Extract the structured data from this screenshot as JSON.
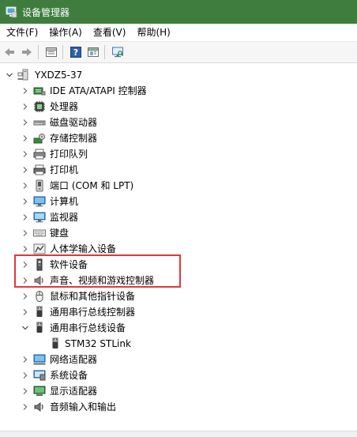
{
  "window": {
    "title": "设备管理器",
    "titlebar_color": "#3f7d3e"
  },
  "menu": {
    "items": [
      {
        "label": "文件(F)"
      },
      {
        "label": "操作(A)"
      },
      {
        "label": "查看(V)"
      },
      {
        "label": "帮助(H)"
      }
    ]
  },
  "toolbar": {
    "buttons": [
      {
        "icon": "back-arrow-icon"
      },
      {
        "icon": "forward-arrow-icon"
      },
      {
        "icon": "properties-icon"
      },
      {
        "icon": "help-icon"
      },
      {
        "icon": "update-driver-icon"
      },
      {
        "icon": "scan-hardware-icon"
      }
    ]
  },
  "tree": {
    "root": {
      "label": "YXDZ5-37",
      "expanded": true
    },
    "categories": [
      {
        "label": "IDE ATA/ATAPI 控制器",
        "icon": "ide-controller-icon",
        "expanded": false
      },
      {
        "label": "处理器",
        "icon": "processor-icon",
        "expanded": false
      },
      {
        "label": "磁盘驱动器",
        "icon": "disk-drive-icon",
        "expanded": false
      },
      {
        "label": "存储控制器",
        "icon": "storage-controller-icon",
        "expanded": false
      },
      {
        "label": "打印队列",
        "icon": "print-queue-icon",
        "expanded": false
      },
      {
        "label": "打印机",
        "icon": "printer-icon",
        "expanded": false
      },
      {
        "label": "端口 (COM 和 LPT)",
        "icon": "port-icon",
        "expanded": false
      },
      {
        "label": "计算机",
        "icon": "computer-icon",
        "expanded": false
      },
      {
        "label": "监视器",
        "icon": "monitor-icon",
        "expanded": false
      },
      {
        "label": "键盘",
        "icon": "keyboard-icon",
        "expanded": false
      },
      {
        "label": "人体学输入设备",
        "icon": "hid-icon",
        "expanded": false
      },
      {
        "label": "软件设备",
        "icon": "software-device-icon",
        "expanded": false
      },
      {
        "label": "声音、视频和游戏控制器",
        "icon": "sound-icon",
        "expanded": false
      },
      {
        "label": "鼠标和其他指针设备",
        "icon": "mouse-icon",
        "expanded": false
      },
      {
        "label": "通用串行总线控制器",
        "icon": "usb-controller-icon",
        "expanded": false
      },
      {
        "label": "通用串行总线设备",
        "icon": "usb-device-icon",
        "expanded": true,
        "children": [
          {
            "label": "STM32 STLink",
            "icon": "usb-device-icon"
          }
        ]
      },
      {
        "label": "网络适配器",
        "icon": "network-adapter-icon",
        "expanded": false
      },
      {
        "label": "系统设备",
        "icon": "system-device-icon",
        "expanded": false
      },
      {
        "label": "显示适配器",
        "icon": "display-adapter-icon",
        "expanded": false
      },
      {
        "label": "音频输入和输出",
        "icon": "audio-io-icon",
        "expanded": false
      }
    ]
  },
  "highlight_color": "#e0373b"
}
